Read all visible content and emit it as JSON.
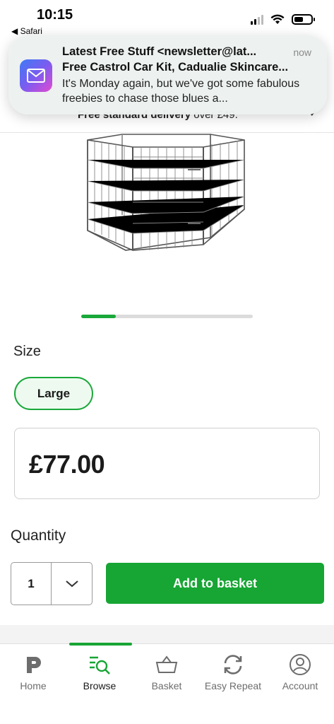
{
  "status_bar": {
    "time": "10:15",
    "back_app": "◀ Safari"
  },
  "notification": {
    "from": "Latest Free Stuff <newsletter@lat...",
    "time": "now",
    "subject": "Free Castrol Car Kit, Cadualie Skincare...",
    "body": "It's Monday again, but we've got some fabulous freebies to chase those blues a..."
  },
  "delivery": {
    "text_bold": "Free standard delivery",
    "text_rest": " over £49."
  },
  "carousel": {
    "progress": 0.2
  },
  "product": {
    "size_label": "Size",
    "size_options": [
      "Large"
    ],
    "selected_size": "Large",
    "price": "£77.00"
  },
  "purchase": {
    "quantity_label": "Quantity",
    "quantity": "1",
    "add_button": "Add to basket"
  },
  "tabs": [
    {
      "label": "Home",
      "icon": "pets-at-home-logo-icon"
    },
    {
      "label": "Browse",
      "icon": "browse-search-icon",
      "active": true
    },
    {
      "label": "Basket",
      "icon": "basket-icon"
    },
    {
      "label": "Easy Repeat",
      "icon": "repeat-icon"
    },
    {
      "label": "Account",
      "icon": "account-icon"
    }
  ],
  "colors": {
    "brand_green": "#17a534",
    "chip_bg": "#eefaf0"
  }
}
